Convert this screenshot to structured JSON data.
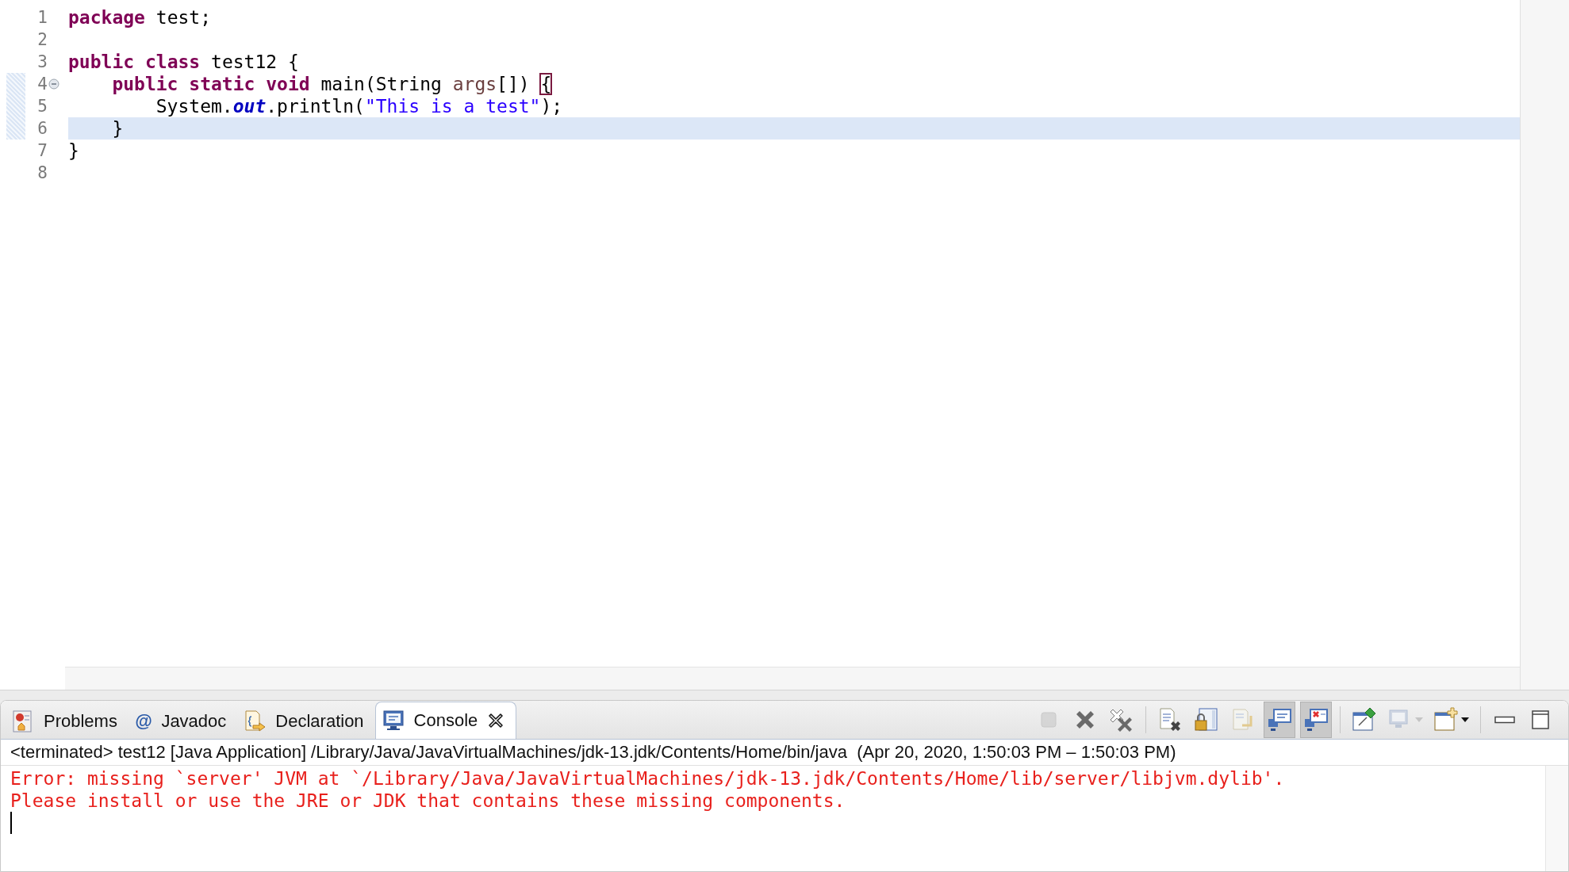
{
  "editor": {
    "lines": [
      {
        "number": "1",
        "current": false,
        "foldable": false,
        "tokens": [
          {
            "kind": "keyword",
            "text": "package "
          },
          {
            "kind": "plain",
            "text": "test;"
          }
        ]
      },
      {
        "number": "2",
        "current": false,
        "foldable": false
      },
      {
        "number": "3",
        "current": false,
        "foldable": false,
        "tokens": [
          {
            "kind": "keyword",
            "text": "public "
          },
          {
            "kind": "keyword",
            "text": "class "
          },
          {
            "kind": "plain",
            "text": "test12 {"
          }
        ]
      },
      {
        "number": "4",
        "current": false,
        "foldable": true,
        "tokens": [
          {
            "kind": "keyword",
            "text": "    public "
          },
          {
            "kind": "keyword",
            "text": "static "
          },
          {
            "kind": "keyword",
            "text": "void "
          },
          {
            "kind": "plain",
            "text": "main(String "
          },
          {
            "kind": "param",
            "text": "args"
          },
          {
            "kind": "plain",
            "text": "[]) "
          },
          {
            "kind": "matched-bracket",
            "text": "{"
          }
        ]
      },
      {
        "number": "5",
        "current": false,
        "foldable": false,
        "tokens": [
          {
            "kind": "plain",
            "text": "        System."
          },
          {
            "kind": "field",
            "text": "out"
          },
          {
            "kind": "plain",
            "text": ".println("
          },
          {
            "kind": "string",
            "text": "\"This is a test\""
          },
          {
            "kind": "plain",
            "text": ");"
          }
        ]
      },
      {
        "number": "6",
        "current": true,
        "foldable": false,
        "tokens": [
          {
            "kind": "plain",
            "text": "    }"
          }
        ]
      },
      {
        "number": "7",
        "current": false,
        "foldable": false,
        "tokens": [
          {
            "kind": "plain",
            "text": "}"
          }
        ]
      },
      {
        "number": "8",
        "current": false,
        "foldable": false
      }
    ]
  },
  "panel": {
    "tabs": [
      {
        "label": "Problems",
        "kind": "problems",
        "selected": false,
        "closable": false
      },
      {
        "label": "Javadoc",
        "kind": "at",
        "glyph": "@",
        "selected": false,
        "closable": false
      },
      {
        "label": "Declaration",
        "kind": "declaration",
        "selected": false,
        "closable": false
      },
      {
        "label": "Console",
        "kind": "console",
        "selected": true,
        "closable": true
      }
    ],
    "toolbar": [
      {
        "kind": "terminate",
        "disabled": true,
        "pressed": false,
        "menu": false
      },
      {
        "kind": "remove-launch",
        "disabled": false,
        "pressed": false,
        "menu": false
      },
      {
        "kind": "remove-all",
        "disabled": false,
        "pressed": false,
        "menu": false
      },
      {
        "kind": "clear",
        "disabled": false,
        "pressed": false,
        "menu": false
      },
      {
        "kind": "scroll-lock",
        "disabled": false,
        "pressed": false,
        "menu": false
      },
      {
        "kind": "word-wrap",
        "disabled": true,
        "pressed": false,
        "menu": false
      },
      {
        "kind": "show-stdout",
        "disabled": false,
        "pressed": true,
        "menu": false
      },
      {
        "kind": "show-stderr",
        "disabled": false,
        "pressed": true,
        "menu": false
      },
      {
        "kind": "pin",
        "disabled": false,
        "pressed": false,
        "menu": false
      },
      {
        "kind": "display-console",
        "disabled": true,
        "pressed": false,
        "menu": true
      },
      {
        "kind": "open-console",
        "disabled": false,
        "pressed": false,
        "menu": true
      },
      {
        "kind": "minimize",
        "disabled": false,
        "pressed": false,
        "menu": false
      },
      {
        "kind": "maximize",
        "disabled": false,
        "pressed": false,
        "menu": false
      }
    ],
    "console": {
      "header": "<terminated> test12 [Java Application] /Library/Java/JavaVirtualMachines/jdk-13.jdk/Contents/Home/bin/java  (Apr 20, 2020, 1:50:03 PM – 1:50:03 PM)",
      "output": [
        {
          "kind": "stderr",
          "text": "Error: missing `server' JVM at `/Library/Java/JavaVirtualMachines/jdk-13.jdk/Contents/Home/lib/server/libjvm.dylib'."
        },
        {
          "kind": "stderr",
          "text": "Please install or use the JRE or JDK that contains these missing components."
        }
      ]
    }
  }
}
